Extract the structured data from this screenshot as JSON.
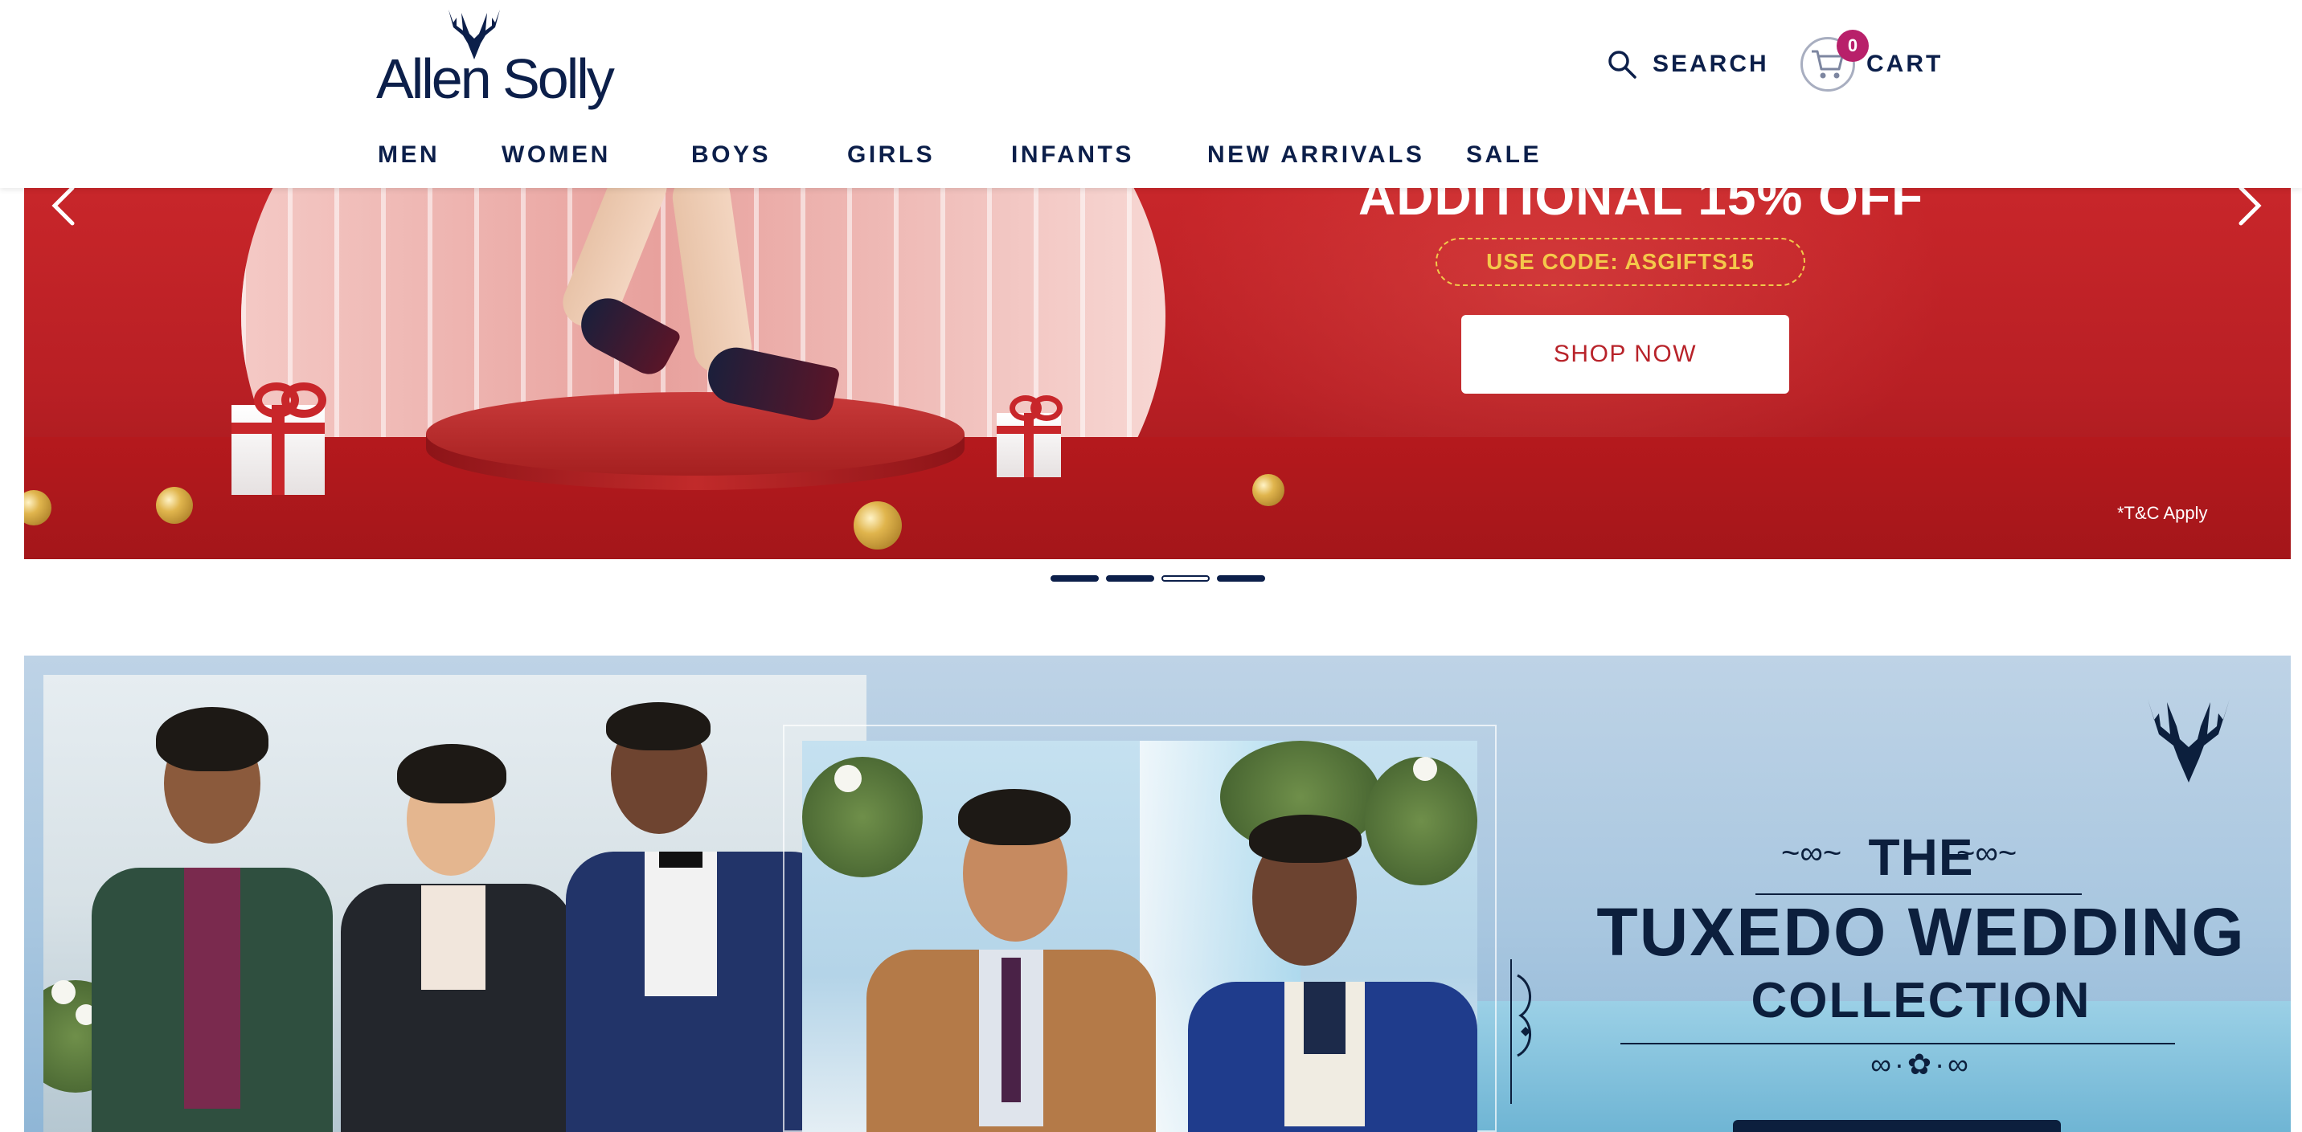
{
  "brand": {
    "name": "Allen Solly",
    "logo_icon": "stag-antlers-icon"
  },
  "header": {
    "search_label": "SEARCH",
    "cart_label": "CART",
    "cart_count": "0"
  },
  "nav": {
    "items": [
      {
        "label": "MEN"
      },
      {
        "label": "WOMEN"
      },
      {
        "label": "BOYS"
      },
      {
        "label": "GIRLS"
      },
      {
        "label": "INFANTS"
      },
      {
        "label": "NEW ARRIVALS"
      },
      {
        "label": "SALE"
      }
    ]
  },
  "hero": {
    "title": "ADDITIONAL 15% OFF",
    "code_text": "USE CODE: ASGIFTS15",
    "cta_label": "SHOP NOW",
    "tnc": "*T&C Apply",
    "prev_icon": "chevron-left-icon",
    "next_icon": "chevron-right-icon",
    "slide_count": 4,
    "active_slide": 3
  },
  "tuxedo": {
    "line1": "THE",
    "line2": "TUXEDO WEDDING",
    "line3": "COLLECTION",
    "brand_icon": "stag-antlers-icon"
  },
  "colors": {
    "navy": "#0c1f4a",
    "hero_red": "#c8262a",
    "badge_magenta": "#b8206a",
    "code_gold": "#f4c84a",
    "tux_blue": "#a9c7e0"
  }
}
